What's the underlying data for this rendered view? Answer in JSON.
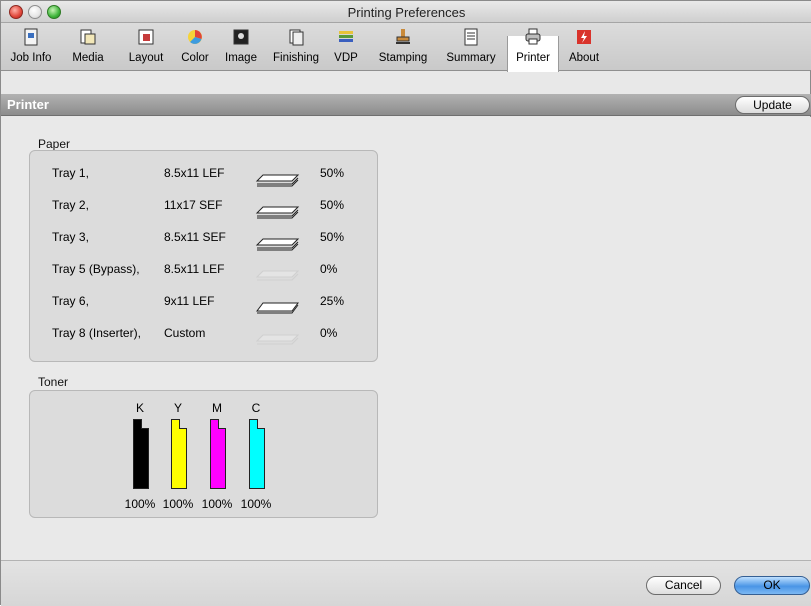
{
  "window": {
    "title": "Printing Preferences"
  },
  "toolbar": {
    "items": [
      {
        "label": "Job Info",
        "icon": "job-info-icon"
      },
      {
        "label": "Media",
        "icon": "media-icon"
      },
      {
        "label": "Layout",
        "icon": "layout-icon"
      },
      {
        "label": "Color",
        "icon": "color-icon"
      },
      {
        "label": "Image",
        "icon": "image-icon"
      },
      {
        "label": "Finishing",
        "icon": "finishing-icon"
      },
      {
        "label": "VDP",
        "icon": "vdp-icon"
      },
      {
        "label": "Stamping",
        "icon": "stamping-icon"
      },
      {
        "label": "Summary",
        "icon": "summary-icon"
      },
      {
        "label": "Printer",
        "icon": "printer-icon",
        "selected": true
      },
      {
        "label": "About",
        "icon": "about-icon"
      }
    ]
  },
  "section": {
    "title": "Printer",
    "update_label": "Update"
  },
  "paper": {
    "label": "Paper",
    "trays": [
      {
        "name": "Tray 1,",
        "size": "8.5x11 LEF",
        "level": "50%",
        "orientation": "stack"
      },
      {
        "name": "Tray 2,",
        "size": "11x17 SEF",
        "level": "50%",
        "orientation": "stack"
      },
      {
        "name": "Tray 3,",
        "size": "8.5x11 SEF",
        "level": "50%",
        "orientation": "stack"
      },
      {
        "name": "Tray 5 (Bypass),",
        "size": "8.5x11 LEF",
        "level": "0%",
        "orientation": "empty"
      },
      {
        "name": "Tray 6,",
        "size": "9x11 LEF",
        "level": "25%",
        "orientation": "single"
      },
      {
        "name": "Tray 8 (Inserter),",
        "size": "Custom",
        "level": "0%",
        "orientation": "empty"
      }
    ]
  },
  "toner": {
    "label": "Toner",
    "cartridges": [
      {
        "label": "K",
        "level": "100%",
        "color": "#000000"
      },
      {
        "label": "Y",
        "level": "100%",
        "color": "#ffff00"
      },
      {
        "label": "M",
        "level": "100%",
        "color": "#ff00ff"
      },
      {
        "label": "C",
        "level": "100%",
        "color": "#00ffff"
      }
    ]
  },
  "footer": {
    "cancel_label": "Cancel",
    "ok_label": "OK"
  }
}
